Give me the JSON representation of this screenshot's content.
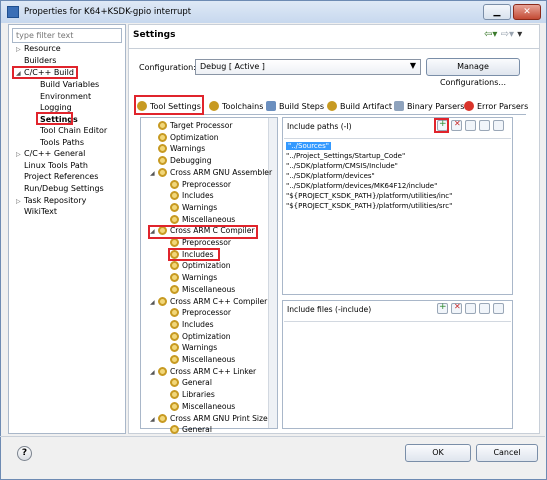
{
  "window": {
    "title": "Properties for K64+KSDK-gpio interrupt"
  },
  "left_nav": {
    "filter_placeholder": "type filter text",
    "items": [
      {
        "label": "Resource",
        "twisty": "▷"
      },
      {
        "label": "Builders",
        "twisty": ""
      },
      {
        "label": "C/C++ Build",
        "twisty": "◢"
      },
      {
        "label": "Build Variables",
        "twisty": ""
      },
      {
        "label": "Environment",
        "twisty": ""
      },
      {
        "label": "Logging",
        "twisty": ""
      },
      {
        "label": "Settings",
        "twisty": ""
      },
      {
        "label": "Tool Chain Editor",
        "twisty": ""
      },
      {
        "label": "Tools Paths",
        "twisty": ""
      },
      {
        "label": "C/C++ General",
        "twisty": "▷"
      },
      {
        "label": "Linux Tools Path",
        "twisty": ""
      },
      {
        "label": "Project References",
        "twisty": ""
      },
      {
        "label": "Run/Debug Settings",
        "twisty": ""
      },
      {
        "label": "Task Repository",
        "twisty": "▷"
      },
      {
        "label": "WikiText",
        "twisty": ""
      }
    ]
  },
  "page": {
    "title": "Settings",
    "configuration_label": "Configuration:",
    "configuration_value": "Debug  [ Active ]",
    "manage_button": "Manage Configurations..."
  },
  "tabs": [
    {
      "label": "Tool Settings"
    },
    {
      "label": "Toolchains"
    },
    {
      "label": "Build Steps"
    },
    {
      "label": "Build Artifact"
    },
    {
      "label": "Binary Parsers"
    },
    {
      "label": "Error Parsers"
    }
  ],
  "tool_tree": [
    {
      "label": "Target Processor",
      "twisty": ""
    },
    {
      "label": "Optimization",
      "twisty": ""
    },
    {
      "label": "Warnings",
      "twisty": ""
    },
    {
      "label": "Debugging",
      "twisty": ""
    },
    {
      "label": "Cross ARM GNU Assembler",
      "twisty": "◢"
    },
    {
      "label": "Preprocessor",
      "twisty": ""
    },
    {
      "label": "Includes",
      "twisty": ""
    },
    {
      "label": "Warnings",
      "twisty": ""
    },
    {
      "label": "Miscellaneous",
      "twisty": ""
    },
    {
      "label": "Cross ARM C Compiler",
      "twisty": "◢"
    },
    {
      "label": "Preprocessor",
      "twisty": ""
    },
    {
      "label": "Includes",
      "twisty": ""
    },
    {
      "label": "Optimization",
      "twisty": ""
    },
    {
      "label": "Warnings",
      "twisty": ""
    },
    {
      "label": "Miscellaneous",
      "twisty": ""
    },
    {
      "label": "Cross ARM C++ Compiler",
      "twisty": "◢"
    },
    {
      "label": "Preprocessor",
      "twisty": ""
    },
    {
      "label": "Includes",
      "twisty": ""
    },
    {
      "label": "Optimization",
      "twisty": ""
    },
    {
      "label": "Warnings",
      "twisty": ""
    },
    {
      "label": "Miscellaneous",
      "twisty": ""
    },
    {
      "label": "Cross ARM C++ Linker",
      "twisty": "◢"
    },
    {
      "label": "General",
      "twisty": ""
    },
    {
      "label": "Libraries",
      "twisty": ""
    },
    {
      "label": "Miscellaneous",
      "twisty": ""
    },
    {
      "label": "Cross ARM GNU Print Size",
      "twisty": "◢"
    },
    {
      "label": "General",
      "twisty": ""
    }
  ],
  "include_paths": {
    "caption": "Include paths (-I)",
    "items": [
      "\"../Sources\"",
      "\"../Project_Settings/Startup_Code\"",
      "\"../SDK/platform/CMSIS/Include\"",
      "\"../SDK/platform/devices\"",
      "\"../SDK/platform/devices/MK64F12/include\"",
      "\"${PROJECT_KSDK_PATH}/platform/utilities/inc\"",
      "\"${PROJECT_KSDK_PATH}/platform/utilities/src\""
    ]
  },
  "include_files": {
    "caption": "Include files (-include)"
  },
  "buttons": {
    "ok": "OK",
    "cancel": "Cancel",
    "help": "?"
  },
  "colors": {
    "highlight": "#e0242c",
    "selection": "#3399ff"
  }
}
